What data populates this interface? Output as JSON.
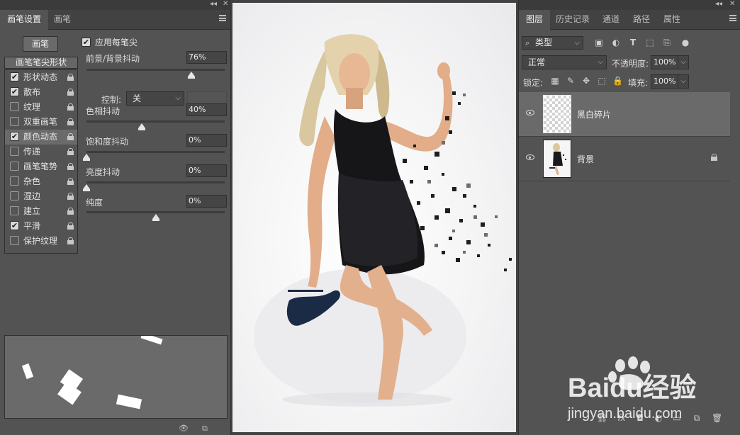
{
  "left_panel": {
    "tabs": [
      {
        "label": "画笔设置",
        "active": true
      },
      {
        "label": "画笔",
        "active": false
      }
    ],
    "brush_button": "画笔",
    "tip_shape_label": "画笔笔尖形状",
    "options": [
      {
        "label": "形状动态",
        "checked": true,
        "selected": false
      },
      {
        "label": "散布",
        "checked": true,
        "selected": false
      },
      {
        "label": "纹理",
        "checked": false,
        "selected": false
      },
      {
        "label": "双重画笔",
        "checked": false,
        "selected": false
      },
      {
        "label": "颜色动态",
        "checked": true,
        "selected": true
      },
      {
        "label": "传递",
        "checked": false,
        "selected": false
      },
      {
        "label": "画笔笔势",
        "checked": false,
        "selected": false
      },
      {
        "label": "杂色",
        "checked": false,
        "selected": false
      },
      {
        "label": "湿边",
        "checked": false,
        "selected": false
      },
      {
        "label": "建立",
        "checked": false,
        "selected": false
      },
      {
        "label": "平滑",
        "checked": true,
        "selected": false
      },
      {
        "label": "保护纹理",
        "checked": false,
        "selected": false
      }
    ],
    "apply_per_tip": {
      "label": "应用每笔尖",
      "checked": true
    },
    "params": {
      "fg_bg_jitter": {
        "label": "前景/背景抖动",
        "value": "76%",
        "level": 0.76
      },
      "control": {
        "label": "控制:",
        "value": "关"
      },
      "hue_jitter": {
        "label": "色相抖动",
        "value": "40%",
        "level": 0.4
      },
      "saturation_jitter": {
        "label": "饱和度抖动",
        "value": "0%",
        "level": 0.0
      },
      "brightness_jitter": {
        "label": "亮度抖动",
        "value": "0%",
        "level": 0.0
      },
      "purity": {
        "label": "纯度",
        "value": "0%",
        "level": 0.5
      }
    }
  },
  "right_panel": {
    "tabs": [
      {
        "label": "图层",
        "active": true
      },
      {
        "label": "历史记录",
        "active": false
      },
      {
        "label": "通道",
        "active": false
      },
      {
        "label": "路径",
        "active": false
      },
      {
        "label": "属性",
        "active": false
      }
    ],
    "filter_kind": "类型",
    "blend_mode": "正常",
    "opacity_label": "不透明度:",
    "opacity_value": "100%",
    "lock_label": "锁定:",
    "fill_label": "填充:",
    "fill_value": "100%",
    "layers": [
      {
        "name": "黑白碎片",
        "selected": true,
        "locked": false
      },
      {
        "name": "背景",
        "selected": false,
        "locked": true
      }
    ]
  },
  "watermark": {
    "brand": "Baidu经验",
    "url": "jingyan.baidu.com"
  }
}
